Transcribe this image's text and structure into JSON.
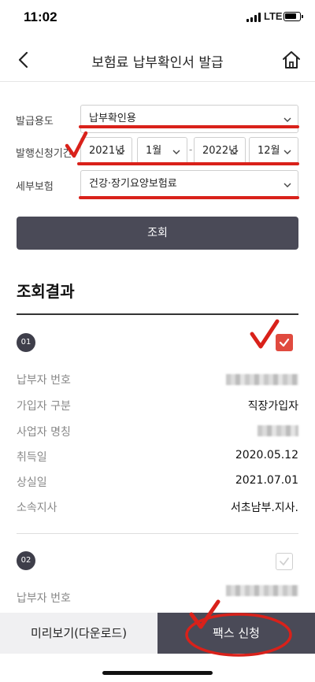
{
  "status_bar": {
    "time": "11:02",
    "network": "LTE"
  },
  "header": {
    "title": "보험료 납부확인서 발급",
    "back_icon": "chevron-left-icon",
    "home_icon": "home-icon"
  },
  "form": {
    "purpose": {
      "label": "발급용도",
      "value": "납부확인용"
    },
    "period": {
      "label": "발행신청기간",
      "start_year": "2021년",
      "start_month": "1월",
      "separator": "-",
      "end_year": "2022년",
      "end_month": "12월"
    },
    "insurance_type": {
      "label": "세부보험",
      "value": "건강·장기요양보험료"
    },
    "search_label": "조회"
  },
  "results": {
    "title": "조회결과",
    "items": [
      {
        "number": "01",
        "checked": true,
        "fields": [
          {
            "label": "납부자 번호",
            "value": ""
          },
          {
            "label": "가입자 구분",
            "value": "직장가입자"
          },
          {
            "label": "사업자 명칭",
            "value": ""
          },
          {
            "label": "취득일",
            "value": "2020.05.12"
          },
          {
            "label": "상실일",
            "value": "2021.07.01"
          },
          {
            "label": "소속지사",
            "value": "서초남부.지사."
          }
        ]
      },
      {
        "number": "02",
        "checked": false,
        "fields": [
          {
            "label": "납부자 번호",
            "value": ""
          }
        ]
      }
    ]
  },
  "bottom_bar": {
    "preview_label": "미리보기(다운로드)",
    "fax_label": "팩스 신청"
  },
  "colors": {
    "dark": "#4a4a57",
    "accent_red": "#d9211a",
    "checkbox_red": "#e04a3f"
  }
}
